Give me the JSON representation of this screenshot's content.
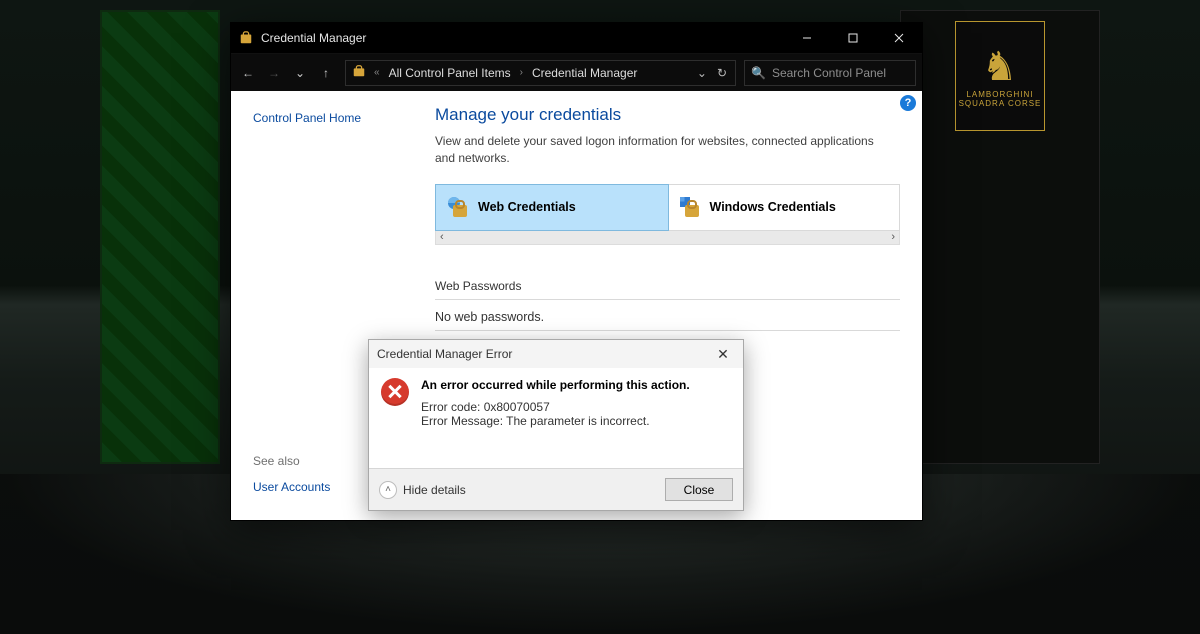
{
  "window": {
    "title": "Credential Manager",
    "search_placeholder": "Search Control Panel"
  },
  "breadcrumb": {
    "item1": "All Control Panel Items",
    "item2": "Credential Manager"
  },
  "sidebar": {
    "home": "Control Panel Home",
    "see_also_label": "See also",
    "user_accounts": "User Accounts"
  },
  "main": {
    "heading": "Manage your credentials",
    "description": "View and delete your saved logon information for websites, connected applications and networks.",
    "tab_web": "Web Credentials",
    "tab_win": "Windows Credentials",
    "section_title": "Web Passwords",
    "empty": "No web passwords."
  },
  "dialog": {
    "title": "Credential Manager Error",
    "headline": "An error occurred while performing this action.",
    "code_line": "Error code: 0x80070057",
    "msg_line": "Error Message: The parameter is incorrect.",
    "hide_details": "Hide details",
    "close": "Close"
  },
  "poster": {
    "brand": "LAMBORGHINI",
    "sub": "SQUADRA CORSE"
  }
}
